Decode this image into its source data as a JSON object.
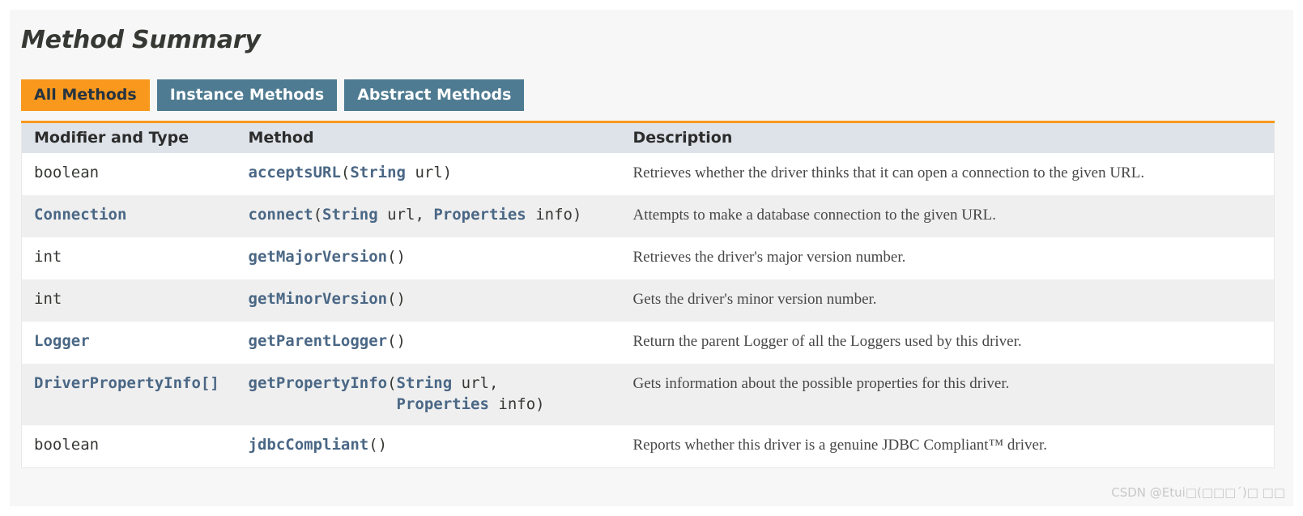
{
  "section": {
    "title": "Method Summary"
  },
  "tabs": [
    {
      "label": "All Methods",
      "state": "active"
    },
    {
      "label": "Instance Methods",
      "state": "inactive"
    },
    {
      "label": "Abstract Methods",
      "state": "inactive"
    }
  ],
  "table": {
    "headers": {
      "modifier": "Modifier and Type",
      "method": "Method",
      "description": "Description"
    },
    "rows": [
      {
        "modifier": "boolean",
        "modifier_is_link": false,
        "method_name": "acceptsURL",
        "method_signature": "(String url)",
        "method_full": "acceptsURL(String url)",
        "description": "Retrieves whether the driver thinks that it can open a connection to the given URL.",
        "shade": "white"
      },
      {
        "modifier": "Connection",
        "modifier_is_link": true,
        "method_name": "connect",
        "method_signature": "(String url, Properties info)",
        "method_full": "connect(String url, Properties info)",
        "description": "Attempts to make a database connection to the given URL.",
        "shade": "gray"
      },
      {
        "modifier": "int",
        "modifier_is_link": false,
        "method_name": "getMajorVersion",
        "method_signature": "()",
        "method_full": "getMajorVersion()",
        "description": "Retrieves the driver's major version number.",
        "shade": "white"
      },
      {
        "modifier": "int",
        "modifier_is_link": false,
        "method_name": "getMinorVersion",
        "method_signature": "()",
        "method_full": "getMinorVersion()",
        "description": "Gets the driver's minor version number.",
        "shade": "gray"
      },
      {
        "modifier": "Logger",
        "modifier_is_link": true,
        "method_name": "getParentLogger",
        "method_signature": "()",
        "method_full": "getParentLogger()",
        "description": "Return the parent Logger of all the Loggers used by this driver.",
        "shade": "white"
      },
      {
        "modifier": "DriverPropertyInfo[]",
        "modifier_is_link": true,
        "method_name": "getPropertyInfo",
        "method_signature": "(String url, Properties info)",
        "method_full": "getPropertyInfo(String url,\n                Properties info)",
        "description": "Gets information about the possible properties for this driver.",
        "shade": "gray"
      },
      {
        "modifier": "boolean",
        "modifier_is_link": false,
        "method_name": "jdbcCompliant",
        "method_signature": "()",
        "method_full": "jdbcCompliant()",
        "description": "Reports whether this driver is a genuine JDBC Compliant™ driver.",
        "shade": "white"
      }
    ]
  },
  "watermark": {
    "text": "CSDN @Etui□(□□□´)□ □□"
  },
  "colors": {
    "active_tab_bg": "#f8981d",
    "inactive_tab_bg": "#4e7b91",
    "header_bg": "#dee3e9",
    "alt_row_bg": "#efefef",
    "link": "#4a6785",
    "page_bg": "#f7f7f7"
  }
}
